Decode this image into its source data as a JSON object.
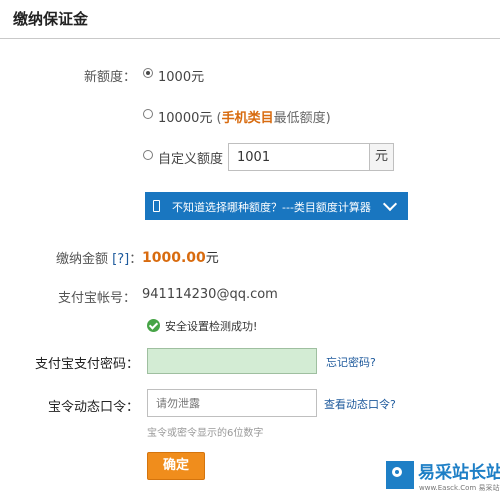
{
  "header": {
    "title": "缴纳保证金"
  },
  "quota": {
    "label": "新额度：",
    "options": [
      {
        "text": "1000元",
        "selected": true
      },
      {
        "text": "10000元",
        "note_open": " (",
        "highlight": "手机类目",
        "note_close": "最低额度)",
        "selected": false
      },
      {
        "text": "自定义额度",
        "selected": false
      }
    ],
    "custom_value": "1001",
    "unit": "元"
  },
  "banner": {
    "text": "不知道选择哪种额度？---类目额度计算器",
    "icon": "phone-icon",
    "chevron": "chevron-down-icon"
  },
  "payment": {
    "label": "缴纳金额",
    "help": "[?]",
    "colon": "：",
    "amount": "1000.00",
    "currency": "元"
  },
  "account": {
    "label": "支付宝帐号：",
    "value": "941114230@qq.com"
  },
  "security_status": "安全设置检测成功!",
  "password": {
    "label": "支付宝支付密码：",
    "value": "",
    "forgot_link": "忘记密码?"
  },
  "token": {
    "label": "宝令动态口令：",
    "placeholder": "请勿泄露",
    "view_link": "查看动态口令?",
    "hint": "宝令或密令显示的6位数字"
  },
  "confirm_button": "确定",
  "watermark": {
    "title": "易采站长站",
    "subtitle": "www.Easck.Com 易采站长站"
  },
  "colors": {
    "accent": "#1976c0",
    "highlight": "#d86b0f",
    "button": "#f08d1c",
    "password_bg": "#d3ecd4"
  }
}
